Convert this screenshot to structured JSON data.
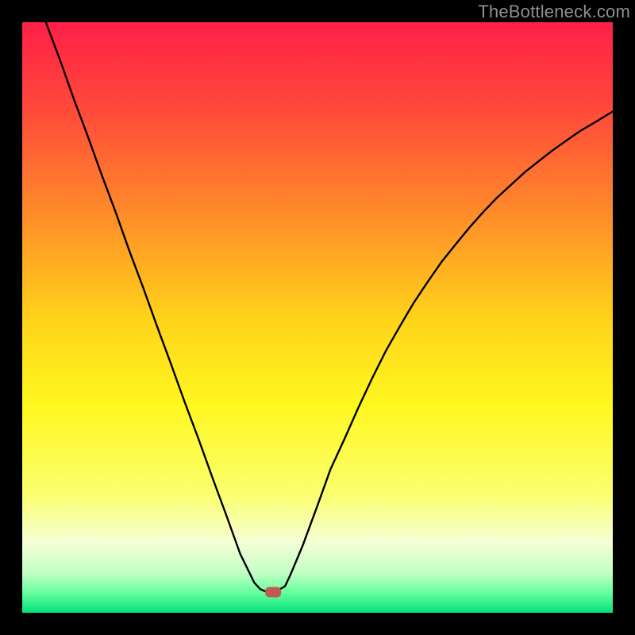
{
  "watermark": "TheBottleneck.com",
  "chart_data": {
    "type": "line",
    "title": "",
    "xlabel": "",
    "ylabel": "",
    "xlim": [
      0,
      100
    ],
    "ylim": [
      0,
      100
    ],
    "background_gradient": {
      "stops": [
        {
          "offset": 0.0,
          "color": "#ff1f48"
        },
        {
          "offset": 0.15,
          "color": "#ff4a3a"
        },
        {
          "offset": 0.32,
          "color": "#ff8a2a"
        },
        {
          "offset": 0.5,
          "color": "#ffd21a"
        },
        {
          "offset": 0.65,
          "color": "#fff820"
        },
        {
          "offset": 0.8,
          "color": "#fbff70"
        },
        {
          "offset": 0.88,
          "color": "#f5ffd6"
        },
        {
          "offset": 0.93,
          "color": "#c6ffc6"
        },
        {
          "offset": 0.965,
          "color": "#6bff9f"
        },
        {
          "offset": 1.0,
          "color": "#00e37c"
        }
      ]
    },
    "marker": {
      "x": 42.5,
      "y": 96.5,
      "color": "#c25757"
    },
    "series": [
      {
        "name": "curve",
        "color": "#000000",
        "x": [
          4.0,
          6.4,
          8.7,
          11.1,
          13.4,
          15.8,
          18.1,
          20.5,
          22.8,
          25.2,
          27.5,
          29.9,
          32.2,
          34.6,
          36.9,
          39.3,
          40.3,
          41.0,
          41.3,
          43.0,
          44.5,
          45.4,
          47.5,
          49.9,
          52.2,
          54.6,
          56.9,
          59.3,
          61.6,
          64.0,
          66.3,
          68.7,
          71.0,
          73.4,
          75.7,
          78.1,
          80.4,
          82.8,
          85.1,
          87.5,
          89.8,
          92.2,
          94.5,
          96.9,
          100.0
        ],
        "y": [
          0.0,
          6.4,
          12.9,
          19.3,
          25.7,
          32.1,
          38.6,
          45.0,
          51.4,
          57.9,
          64.3,
          70.7,
          77.1,
          83.6,
          90.0,
          94.9,
          96.0,
          96.3,
          96.4,
          96.4,
          95.5,
          93.6,
          88.6,
          82.1,
          75.7,
          70.5,
          65.3,
          60.2,
          55.6,
          51.4,
          47.5,
          43.9,
          40.6,
          37.6,
          34.8,
          32.1,
          29.7,
          27.5,
          25.4,
          23.5,
          21.7,
          20.0,
          18.4,
          17.0,
          15.1
        ]
      }
    ]
  }
}
